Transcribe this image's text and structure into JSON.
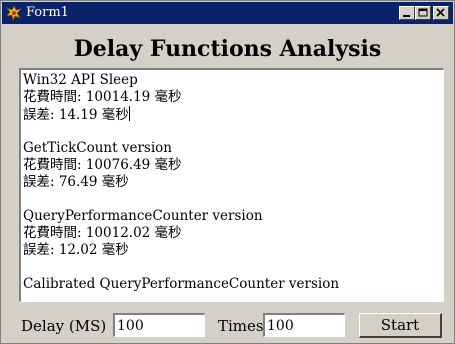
{
  "window": {
    "title": "Form1",
    "icon": "delphi-app-icon",
    "controls": [
      "minimize-icon",
      "maximize-icon",
      "close-icon"
    ]
  },
  "heading": "Delay Functions Analysis",
  "memo": {
    "lines": [
      "Win32 API Sleep",
      "花費時間: 10014.19 毫秒",
      "誤差: 14.19 毫秒",
      "",
      "GetTickCount version",
      "花費時間: 10076.49 毫秒",
      "誤差: 76.49 毫秒",
      "",
      "QueryPerformanceCounter version",
      "花費時間: 10012.02 毫秒",
      "誤差: 12.02 毫秒",
      "",
      "Calibrated QueryPerformanceCounter version"
    ]
  },
  "controls": {
    "delay_label": "Delay (MS)",
    "delay_value": "100",
    "times_label": "Times",
    "times_value": "100",
    "start_label": "Start"
  },
  "colors": {
    "titlebar": "#0a246a",
    "face": "#d4d0c8"
  }
}
